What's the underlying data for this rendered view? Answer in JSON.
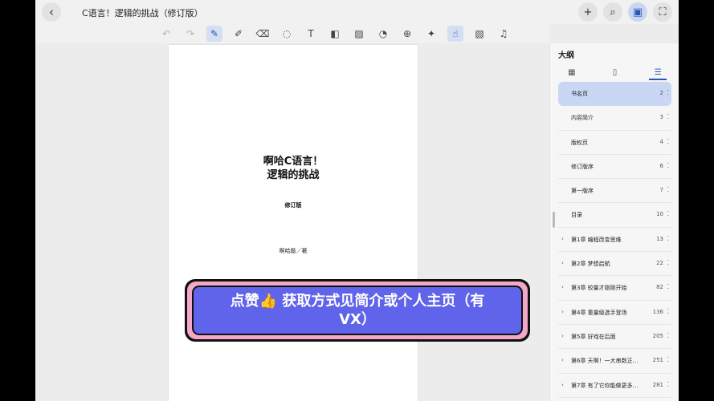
{
  "header": {
    "back_icon": "chevron-left-icon",
    "title": "C语言！逻辑的挑战（修订版）",
    "actions": [
      {
        "name": "add-icon",
        "glyph": "+"
      },
      {
        "name": "search-icon",
        "glyph": "⌕"
      },
      {
        "name": "sidebar-toggle-icon",
        "glyph": "▣"
      },
      {
        "name": "fullscreen-icon",
        "glyph": "⛶"
      }
    ]
  },
  "toolbar": {
    "tools": [
      {
        "name": "undo-icon",
        "glyph": "↶",
        "state": "disabled"
      },
      {
        "name": "redo-icon",
        "glyph": "↷",
        "state": "disabled"
      },
      {
        "name": "pen-icon",
        "glyph": "✎",
        "state": "active"
      },
      {
        "name": "marker-icon",
        "glyph": "✐",
        "state": "normal"
      },
      {
        "name": "eraser-icon",
        "glyph": "⌫",
        "state": "normal"
      },
      {
        "name": "lasso-icon",
        "glyph": "◌",
        "state": "normal"
      },
      {
        "name": "text-box-icon",
        "glyph": "T",
        "state": "normal"
      },
      {
        "name": "shapes-icon",
        "glyph": "◧",
        "state": "normal"
      },
      {
        "name": "image-icon",
        "glyph": "▨",
        "state": "normal"
      },
      {
        "name": "sticker-icon",
        "glyph": "◔",
        "state": "normal"
      },
      {
        "name": "zoom-icon",
        "glyph": "⊕",
        "state": "normal"
      },
      {
        "name": "laser-pointer-icon",
        "glyph": "✦",
        "state": "normal"
      },
      {
        "name": "touch-draw-icon",
        "glyph": "☝",
        "state": "active"
      },
      {
        "name": "hatch-icon",
        "glyph": "▧",
        "state": "normal"
      },
      {
        "name": "microphone-icon",
        "glyph": "♫",
        "state": "normal"
      }
    ]
  },
  "page": {
    "title_line1": "啊哈C语言！",
    "title_line2": "逻辑的挑战",
    "subtitle": "修订版",
    "author": "啊哈磊／著"
  },
  "sidebar": {
    "title": "大纲",
    "tabs": [
      {
        "name": "tab-thumbnails",
        "glyph": "▦",
        "active": false
      },
      {
        "name": "tab-bookmarks",
        "glyph": "▯",
        "active": false
      },
      {
        "name": "tab-outline",
        "glyph": "☰",
        "active": true
      }
    ],
    "toc": [
      {
        "label": "书名页",
        "page": "2",
        "expandable": false,
        "active": true
      },
      {
        "label": "内容简介",
        "page": "3",
        "expandable": false,
        "active": false
      },
      {
        "label": "版权页",
        "page": "4",
        "expandable": false,
        "active": false
      },
      {
        "label": "修订版序",
        "page": "6",
        "expandable": false,
        "active": false
      },
      {
        "label": "第一版序",
        "page": "7",
        "expandable": false,
        "active": false
      },
      {
        "label": "目录",
        "page": "10",
        "expandable": false,
        "active": false
      },
      {
        "label": "第1章 编程改变思维",
        "page": "13",
        "expandable": true,
        "active": false
      },
      {
        "label": "第2章 梦想启航",
        "page": "22",
        "expandable": true,
        "active": false
      },
      {
        "label": "第3章 较量才刚刚开始",
        "page": "82",
        "expandable": true,
        "active": false
      },
      {
        "label": "第4章 重量级选手登场",
        "page": "136",
        "expandable": true,
        "active": false
      },
      {
        "label": "第5章 好戏在后面",
        "page": "205",
        "expandable": true,
        "active": false
      },
      {
        "label": "第6章 天啊！一大串数正…",
        "page": "251",
        "expandable": true,
        "active": false
      },
      {
        "label": "第7章 有了它你能做更多…",
        "page": "281",
        "expandable": true,
        "active": false
      }
    ]
  },
  "banner": {
    "line1": "点赞👍 获取方式见简介或个人主页（有",
    "line2": "VX）"
  }
}
